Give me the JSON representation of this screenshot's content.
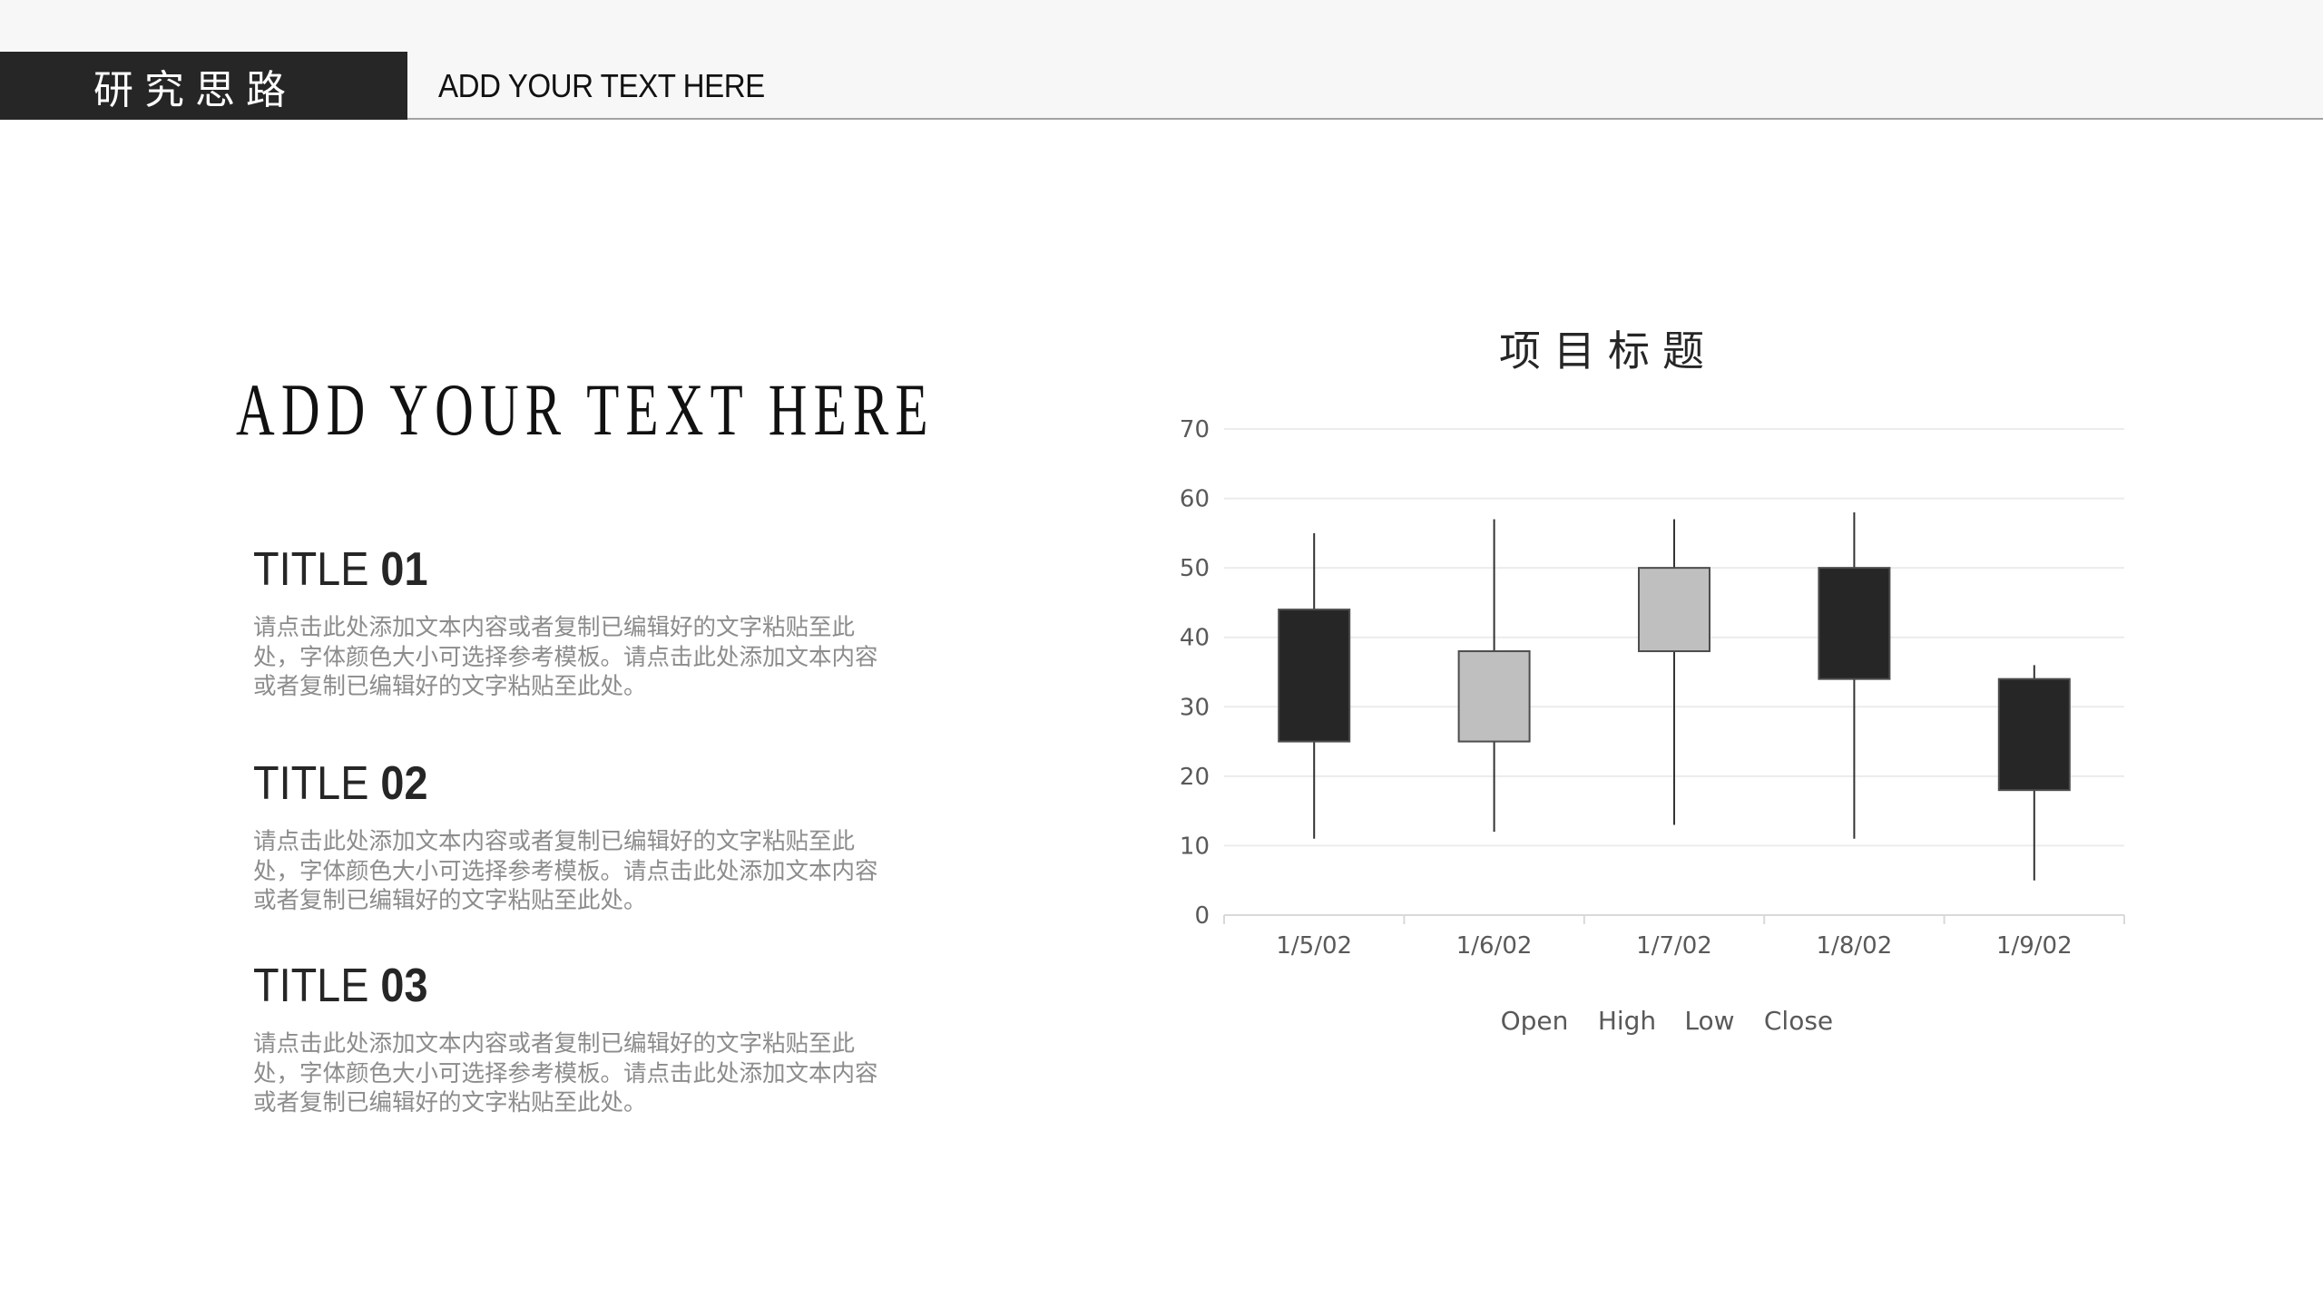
{
  "header": {
    "section_label": "研究思路",
    "subtitle": "ADD YOUR TEXT HERE"
  },
  "main": {
    "big_title": "ADD YOUR TEXT HERE",
    "sections": [
      {
        "title_word": "TITLE",
        "title_num": "01",
        "body": "请点击此处添加文本内容或者复制已编辑好的文字粘贴至此处，字体颜色大小可选择参考模板。请点击此处添加文本内容或者复制已编辑好的文字粘贴至此处。"
      },
      {
        "title_word": "TITLE",
        "title_num": "02",
        "body": "请点击此处添加文本内容或者复制已编辑好的文字粘贴至此处，字体颜色大小可选择参考模板。请点击此处添加文本内容或者复制已编辑好的文字粘贴至此处。"
      },
      {
        "title_word": "TITLE",
        "title_num": "03",
        "body": "请点击此处添加文本内容或者复制已编辑好的文字粘贴至此处，字体颜色大小可选择参考模板。请点击此处添加文本内容或者复制已编辑好的文字粘贴至此处。"
      }
    ]
  },
  "chart_data": {
    "type": "candlestick",
    "title": "项目标题",
    "categories": [
      "1/5/02",
      "1/6/02",
      "1/7/02",
      "1/8/02",
      "1/9/02"
    ],
    "series": [
      {
        "name": "Open",
        "values": [
          44,
          25,
          38,
          50,
          34
        ]
      },
      {
        "name": "High",
        "values": [
          55,
          57,
          57,
          58,
          36
        ]
      },
      {
        "name": "Low",
        "values": [
          11,
          12,
          13,
          11,
          5
        ]
      },
      {
        "name": "Close",
        "values": [
          25,
          38,
          50,
          34,
          18
        ]
      }
    ],
    "legend": [
      "Open",
      "High",
      "Low",
      "Close"
    ],
    "legend_position": "bottom",
    "ylim": [
      0,
      70
    ],
    "yticks": [
      0,
      10,
      20,
      30,
      40,
      50,
      60,
      70
    ],
    "grid": true,
    "xlabel": "",
    "ylabel": "",
    "colors": {
      "up": "#bfbfbf",
      "down": "#262626",
      "border": "#4d4d4d",
      "grid": "#ececec",
      "axis": "#d9d9d9"
    }
  }
}
